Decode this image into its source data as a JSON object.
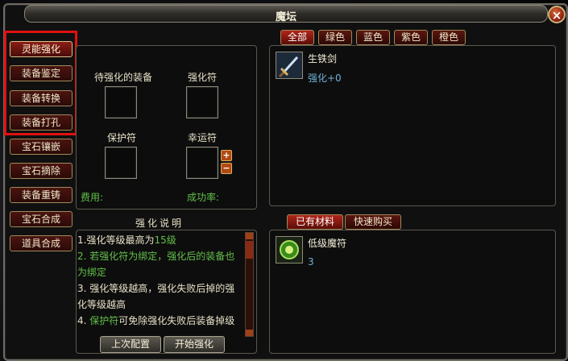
{
  "window": {
    "title": "魔坛",
    "close_label": "×"
  },
  "sidebar": {
    "items": [
      {
        "label": "灵能强化",
        "active": true
      },
      {
        "label": "装备鉴定",
        "active": false
      },
      {
        "label": "装备转换",
        "active": false
      },
      {
        "label": "装备打孔",
        "active": false
      },
      {
        "label": "宝石镶嵌",
        "active": false
      },
      {
        "label": "宝石摘除",
        "active": false
      },
      {
        "label": "装备重铸",
        "active": false
      },
      {
        "label": "宝石合成",
        "active": false
      },
      {
        "label": "道具合成",
        "active": false
      }
    ]
  },
  "enhance": {
    "equip_label": "待强化的装备",
    "rune_label": "强化符",
    "protect_label": "保护符",
    "luck_label": "幸运符",
    "cost_label": "费用:",
    "rate_label": "成功率:",
    "plus": "+",
    "minus": "−"
  },
  "description": {
    "title": "强化说明",
    "line1_a": "1.强化等级最高为",
    "line1_b": "15级",
    "line2": "2. 若强化符为绑定，强化后的装备也为绑定",
    "line3": "3. 强化等级越高，强化失败后掉的强化等级越高",
    "line4_a": "4. ",
    "line4_b": "保护符",
    "line4_c": "可免除强化失败后装备掉级"
  },
  "buttons": {
    "last_config": "上次配置",
    "start": "开始强化"
  },
  "filter_tabs": [
    "全部",
    "绿色",
    "蓝色",
    "紫色",
    "橙色"
  ],
  "equipment_list": [
    {
      "name": "生铁剑",
      "sub": "强化+0",
      "icon": "sword-icon"
    }
  ],
  "material_tabs": [
    "已有材料",
    "快速购买"
  ],
  "material_list": [
    {
      "name": "低级魔符",
      "count": "3",
      "icon": "rune-icon"
    }
  ],
  "colors": {
    "accent_red": "#8a1e16",
    "highlight": "#e01010",
    "text_green": "#63c04a",
    "text_blue": "#6fb3d8"
  }
}
